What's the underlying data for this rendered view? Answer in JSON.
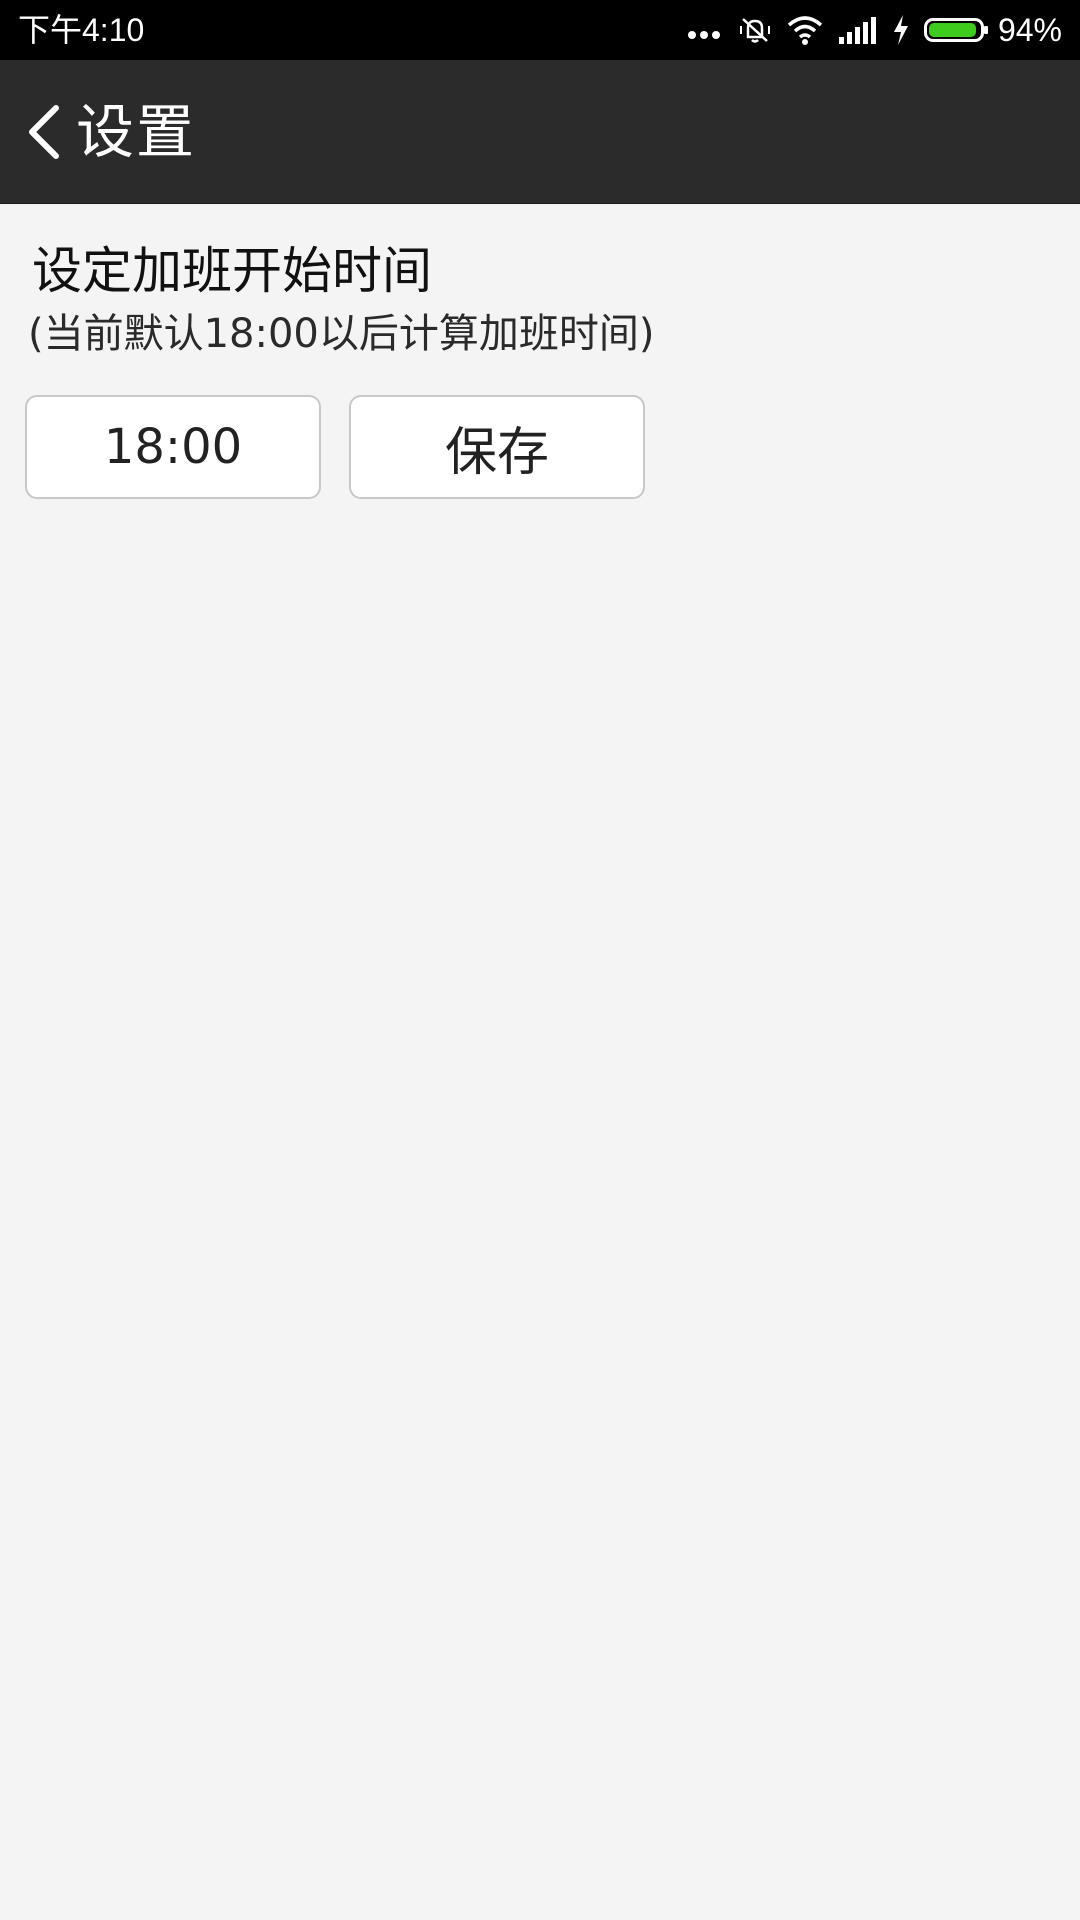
{
  "status_bar": {
    "time": "下午4:10",
    "battery_percent": "94%",
    "battery_level": 0.94,
    "icons": [
      "more-dots-icon",
      "vibrate-mute-icon",
      "wifi-icon",
      "signal-icon",
      "charging-icon",
      "battery-icon"
    ],
    "battery_color": "#3fcb1e"
  },
  "title_bar": {
    "title": "设置",
    "back_icon": "chevron-left-icon",
    "background": "#2b2b2b"
  },
  "overtime": {
    "title": "设定加班开始时间",
    "subtitle": "(当前默认18:00以后计算加班时间)",
    "time_value": "18:00",
    "save_label": "保存"
  }
}
